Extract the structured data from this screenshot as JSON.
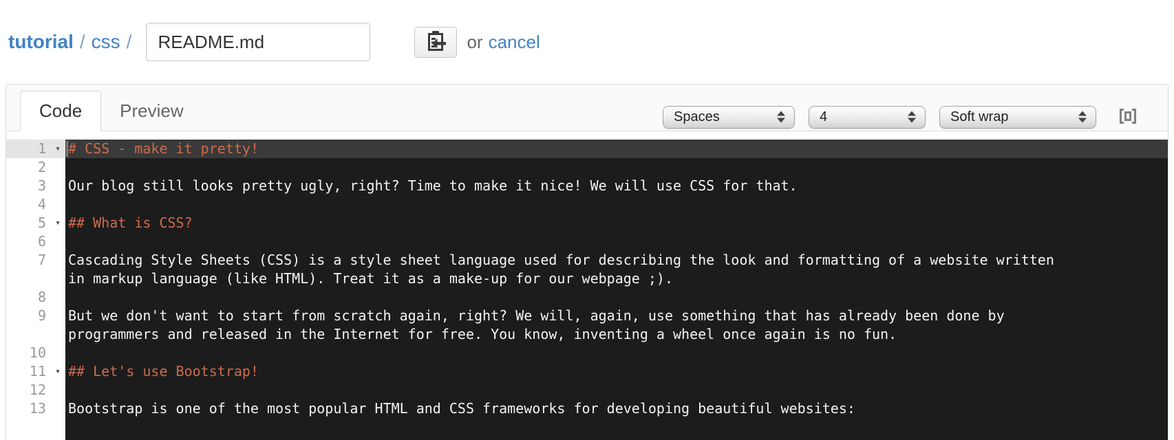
{
  "breadcrumb": {
    "repo": "tutorial",
    "separator": "/",
    "dir": "css",
    "separator2": "/"
  },
  "file": {
    "name_value": "README.md"
  },
  "actions": {
    "or_text": "or",
    "cancel_label": "cancel"
  },
  "tabs": {
    "code_label": "Code",
    "preview_label": "Preview"
  },
  "editor_controls": {
    "indent_mode": "Spaces",
    "indent_width": "4",
    "wrap_mode": "Soft wrap"
  },
  "icons": {
    "fold": "▾",
    "commit_icon": "clipboard-arrow",
    "fullscreen_icon": "screen-full"
  },
  "colors": {
    "accent_blue": "#4183c4",
    "heading_orange": "#cc6b4e",
    "editor_background": "#1c1c1c",
    "active_line": "#3a3a3a",
    "gutter_active": "#e4e4e4"
  },
  "editor": {
    "lines": [
      {
        "num": "1",
        "text": "# CSS - make it pretty!"
      },
      {
        "num": "2",
        "text": ""
      },
      {
        "num": "3",
        "text": "Our blog still looks pretty ugly, right? Time to make it nice! We will use CSS for that."
      },
      {
        "num": "4",
        "text": ""
      },
      {
        "num": "5",
        "text": "## What is CSS?"
      },
      {
        "num": "6",
        "text": ""
      },
      {
        "num": "7",
        "text": "Cascading Style Sheets (CSS) is a style sheet language used for describing the look and formatting of a website written in markup language (like HTML). Treat it as a make-up for our webpage ;)."
      },
      {
        "num": "8",
        "text": ""
      },
      {
        "num": "9",
        "text": "But we don't want to start from scratch again, right? We will, again, use something that has already been done by programmers and released in the Internet for free. You know, inventing a wheel once again is no fun."
      },
      {
        "num": "10",
        "text": ""
      },
      {
        "num": "11",
        "text": "## Let's use Bootstrap!"
      },
      {
        "num": "12",
        "text": ""
      },
      {
        "num": "13",
        "text": "Bootstrap is one of the most popular HTML and CSS frameworks for developing beautiful websites:"
      }
    ]
  }
}
